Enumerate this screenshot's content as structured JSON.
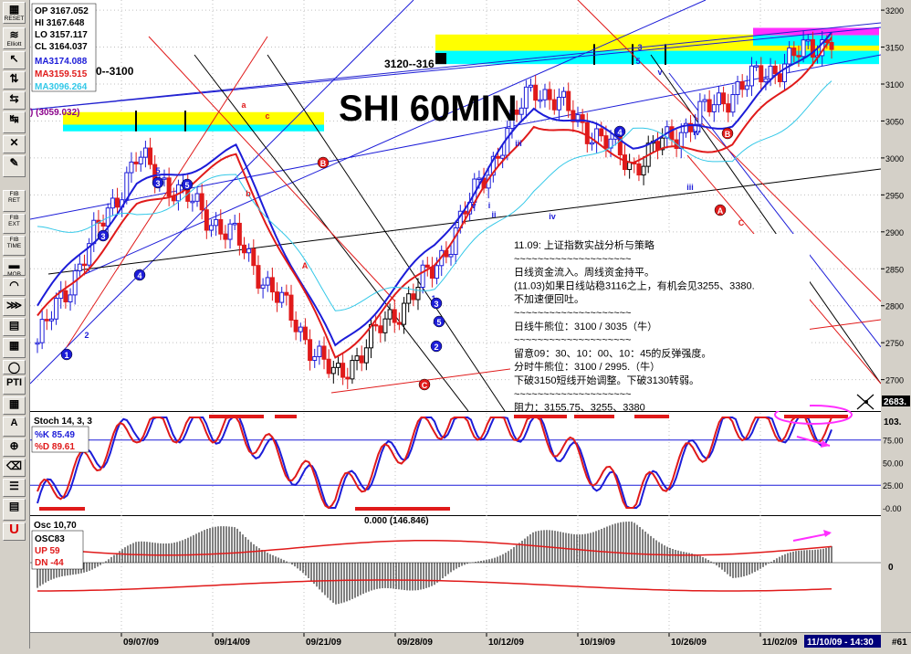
{
  "toolbar": {
    "buttons": [
      {
        "icon": "grid-icon",
        "label": "RESET"
      },
      {
        "icon": "elliott-icon",
        "label": "Elliott"
      },
      {
        "icon": "cursor-icon",
        "label": ""
      },
      {
        "icon": "text-cursor-icon",
        "label": ""
      },
      {
        "icon": "arrows-icon",
        "label": ""
      },
      {
        "icon": "zoom-icon",
        "label": ""
      },
      {
        "icon": "cross-icon",
        "label": ""
      },
      {
        "icon": "pencil-icon",
        "label": ""
      },
      {
        "icon": "fib-ret-icon",
        "label": "FIB RET"
      },
      {
        "icon": "fib-ext-icon",
        "label": "FIB EXT"
      },
      {
        "icon": "fib-time-icon",
        "label": "FIB TIME"
      },
      {
        "icon": "mob-icon",
        "label": "MOB"
      },
      {
        "icon": "fib-arc-icon",
        "label": ""
      },
      {
        "icon": "fan-icon",
        "label": ""
      },
      {
        "icon": "channel-icon",
        "label": ""
      },
      {
        "icon": "grid2-icon",
        "label": ""
      },
      {
        "icon": "ellipse-icon",
        "label": "ELIPS"
      },
      {
        "icon": "pti-icon",
        "label": "PTI"
      },
      {
        "icon": "table-icon",
        "label": ""
      },
      {
        "icon": "text-tool-icon",
        "label": "A"
      },
      {
        "icon": "magnifier-icon",
        "label": ""
      },
      {
        "icon": "eraser-icon",
        "label": ""
      },
      {
        "icon": "properties-icon",
        "label": ""
      },
      {
        "icon": "notes-icon",
        "label": ""
      },
      {
        "icon": "magnet-icon",
        "label": ""
      }
    ]
  },
  "price_panel": {
    "ohlc": {
      "op": "OP 3167.052",
      "hi": "HI  3167.648",
      "lo": "LO 3157.117",
      "cl": "CL 3164.037"
    },
    "ma_labels": [
      {
        "text": "MA3174.088",
        "color": "#1c1cd8"
      },
      {
        "text": "MA3159.515",
        "color": "#e01a1a"
      },
      {
        "text": "MA3096.264",
        "color": "#33c8e8"
      }
    ],
    "title": "SHI 60MIN",
    "label_left": "0--3100",
    "label_mid": "3120--316",
    "label_059": ") (3059.032)",
    "current_value": "2683.",
    "axis_ticks": [
      "3200",
      "3150",
      "3100",
      "3050",
      "3000",
      "2950",
      "2900",
      "2850",
      "2800",
      "2750",
      "2700"
    ],
    "elliott_labels": [
      {
        "t": "1",
        "c": "b"
      },
      {
        "t": "2",
        "c": "b"
      },
      {
        "t": "3",
        "c": "b"
      },
      {
        "t": "4",
        "c": "b"
      },
      {
        "t": "5",
        "c": "b"
      },
      {
        "t": "3",
        "c": "b"
      },
      {
        "t": "5",
        "c": "b"
      },
      {
        "t": "a",
        "c": "r"
      },
      {
        "t": "b",
        "c": "r"
      },
      {
        "t": "c",
        "c": "r"
      },
      {
        "t": "A",
        "c": "r"
      },
      {
        "t": "B",
        "c": "r"
      },
      {
        "t": "C",
        "c": "r"
      },
      {
        "t": "1",
        "c": "b"
      },
      {
        "t": "2",
        "c": "b"
      },
      {
        "t": "3",
        "c": "b"
      },
      {
        "t": "4",
        "c": "b"
      },
      {
        "t": "5",
        "c": "b"
      },
      {
        "t": "iii",
        "c": "b"
      },
      {
        "t": "iv",
        "c": "b"
      },
      {
        "t": "v",
        "c": "b"
      },
      {
        "t": "i",
        "c": "b"
      },
      {
        "t": "ii",
        "c": "b"
      },
      {
        "t": "A",
        "c": "r"
      },
      {
        "t": "B",
        "c": "r"
      },
      {
        "t": "C",
        "c": "r"
      },
      {
        "t": "4",
        "c": "b"
      },
      {
        "t": "3",
        "c": "b"
      },
      {
        "t": "5",
        "c": "b"
      },
      {
        "t": "v",
        "c": "b"
      },
      {
        "t": "iii",
        "c": "b"
      },
      {
        "t": "iv",
        "c": "b"
      }
    ],
    "notes": [
      "11.09: 上证指数实战分析与策略",
      "~~~~~~~~~~~~~~~~~~~~",
      "日线资金流入。周线资金持平。",
      "(11.03)如果日线站稳3116之上，有机会见3255、3380.",
      "不加速便回吐。",
      "~~~~~~~~~~~~~~~~~~~~",
      "日线牛熊位：3100 / 3035（牛）",
      "~~~~~~~~~~~~~~~~~~~~",
      "留意09：30、10：00、10：45的反弹强度。",
      "分时牛熊位：3100 / 2995.（牛）",
      "下破3150短线开始调整。下破3130转弱。",
      "~~~~~~~~~~~~~~~~~~~~",
      "阻力：3155.75、3255、3380"
    ]
  },
  "stoch_panel": {
    "title": "Stoch 14, 3, 3",
    "k_label": "%K  85.49",
    "d_label": "%D  89.61",
    "axis_ticks": [
      "103.",
      "75.00",
      "50.00",
      "25.00",
      "-0.00"
    ]
  },
  "osc_panel": {
    "title": "Osc 10,70",
    "name": "OSC83",
    "up": "UP   59",
    "dn": "DN   -44",
    "zero_label": "0.000 (146.846)",
    "axis_zero": "0"
  },
  "x_axis": {
    "dates": [
      "09/07/09",
      "09/14/09",
      "09/21/09",
      "09/28/09",
      "10/12/09",
      "10/19/09",
      "10/26/09",
      "11/02/09"
    ],
    "cursor": "11/10/09 - 14:30",
    "corner": "#61"
  },
  "colors": {
    "blue": "#1c1cd8",
    "red": "#e01a1a",
    "cyan": "#33c8e8",
    "yellow": "#ffff00",
    "magenta": "#ff2fff",
    "black": "#000000"
  },
  "chart_data": [
    {
      "type": "line",
      "title": "SHI 60MIN",
      "ylim": [
        2660,
        3210
      ],
      "x": [
        "09/07/09",
        "09/14/09",
        "09/21/09",
        "09/28/09",
        "10/12/09",
        "10/19/09",
        "10/26/09",
        "11/02/09",
        "11/10/09"
      ],
      "series": [
        {
          "name": "close",
          "values": [
            2750,
            3000,
            2890,
            2700,
            2850,
            3100,
            2990,
            3090,
            3164.037
          ]
        },
        {
          "name": "MA3174.088",
          "values": [
            2800,
            2960,
            3010,
            2740,
            2880,
            3070,
            3020,
            3050,
            3174.088
          ]
        },
        {
          "name": "MA3159.515",
          "values": [
            2780,
            2930,
            3000,
            2730,
            2860,
            3050,
            3000,
            3020,
            3159.515
          ]
        },
        {
          "name": "MA3096.264",
          "values": [
            2900,
            2920,
            2980,
            2800,
            2830,
            2960,
            3040,
            2990,
            3096.264
          ]
        }
      ]
    },
    {
      "type": "line",
      "title": "Stoch 14, 3, 3",
      "ylim": [
        0,
        103
      ],
      "x": [
        "09/07/09",
        "09/14/09",
        "09/21/09",
        "09/28/09",
        "10/12/09",
        "10/19/09",
        "10/26/09",
        "11/02/09",
        "11/10/09"
      ],
      "series": [
        {
          "name": "%K",
          "values": [
            5,
            92,
            88,
            10,
            96,
            90,
            5,
            95,
            85.49
          ]
        },
        {
          "name": "%D",
          "values": [
            8,
            90,
            90,
            12,
            94,
            92,
            8,
            93,
            89.61
          ]
        }
      ]
    },
    {
      "type": "bar",
      "title": "Osc 10,70",
      "x": [
        "09/07/09",
        "09/14/09",
        "09/21/09",
        "09/28/09",
        "10/12/09",
        "10/19/09",
        "10/26/09",
        "11/02/09",
        "11/10/09"
      ],
      "series": [
        {
          "name": "OSC83",
          "values": [
            -40,
            25,
            52,
            -55,
            -30,
            40,
            55,
            -20,
            30
          ]
        },
        {
          "name": "UP",
          "values": [
            59,
            59,
            59,
            59,
            59,
            59,
            59,
            59,
            59
          ]
        },
        {
          "name": "DN",
          "values": [
            -44,
            -44,
            -44,
            -44,
            -44,
            -44,
            -44,
            -44,
            -44
          ]
        }
      ]
    }
  ]
}
